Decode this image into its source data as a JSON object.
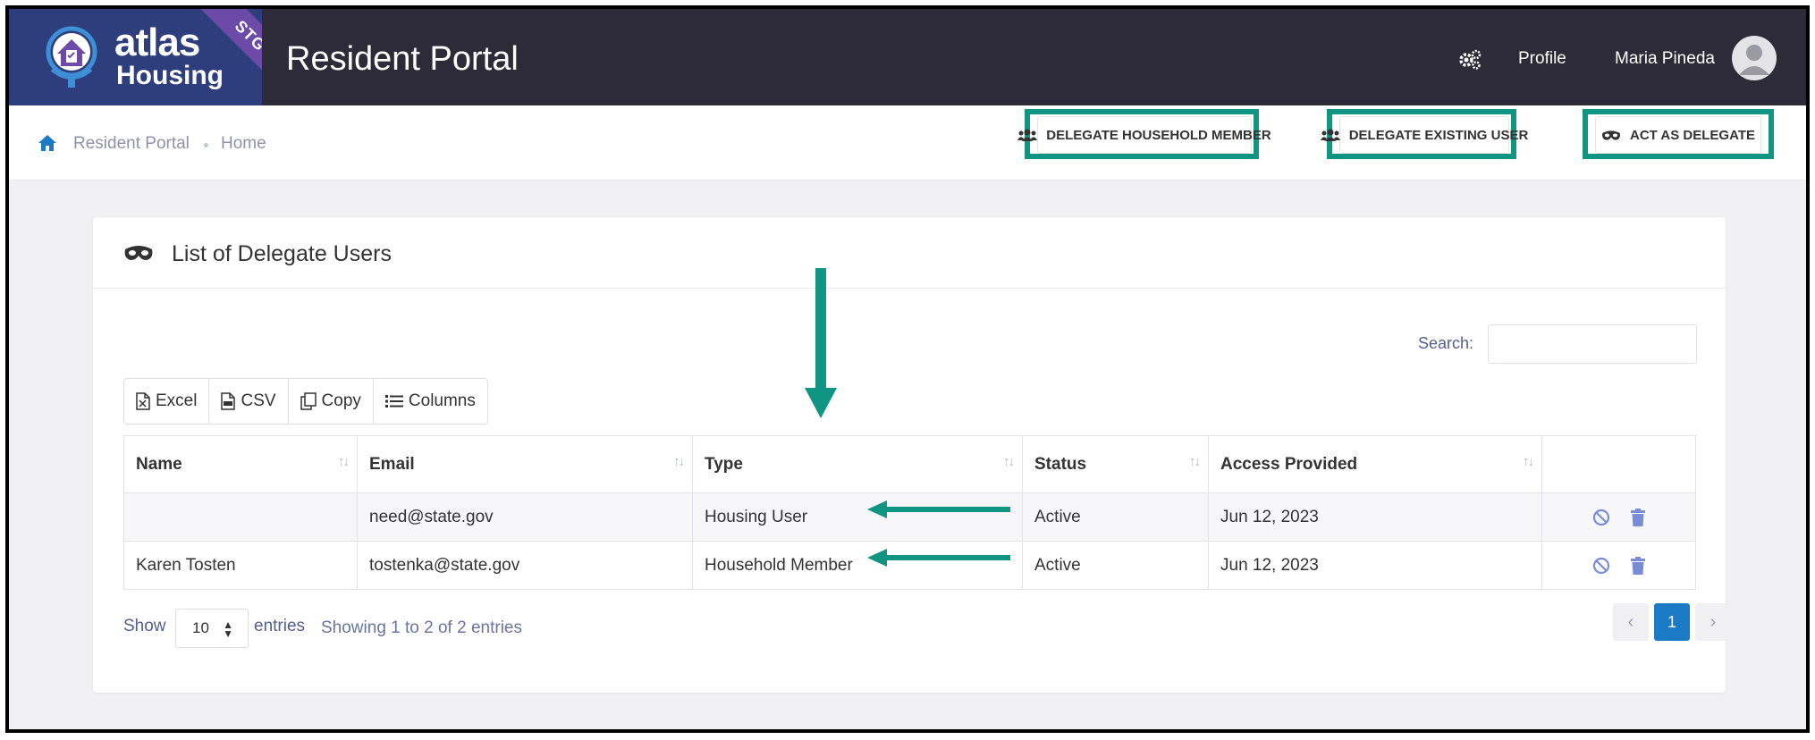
{
  "header": {
    "logo_line1": "atlas",
    "logo_line2": "Housing",
    "env_badge": "STG",
    "app_title": "Resident Portal",
    "settings_icon": "gears-icon",
    "profile_label": "Profile",
    "user_name": "Maria Pineda"
  },
  "breadcrumb": {
    "items": [
      "Resident Portal",
      "Home"
    ]
  },
  "actions": {
    "delegate_household": "DELEGATE HOUSEHOLD MEMBER",
    "delegate_existing": "DELEGATE EXISTING USER",
    "act_as_delegate": "ACT AS DELEGATE"
  },
  "card": {
    "title": "List of Delegate Users"
  },
  "search": {
    "label": "Search:",
    "value": ""
  },
  "export_buttons": {
    "excel": "Excel",
    "csv": "CSV",
    "copy": "Copy",
    "columns": "Columns"
  },
  "table": {
    "columns": [
      "Name",
      "Email",
      "Type",
      "Status",
      "Access Provided",
      ""
    ],
    "rows": [
      {
        "name": "",
        "email": "need@state.gov",
        "type": "Housing User",
        "status": "Active",
        "access": "Jun 12, 2023"
      },
      {
        "name": "Karen Tosten",
        "email": "tostenka@state.gov",
        "type": "Household Member",
        "status": "Active",
        "access": "Jun 12, 2023"
      }
    ]
  },
  "footer": {
    "show_label": "Show",
    "page_length": "10",
    "entries_label": "entries",
    "info": "Showing 1 to 2 of 2 entries",
    "current_page": "1",
    "prev_symbol": "‹",
    "next_symbol": "›"
  },
  "colors": {
    "header_bg": "#2c2b37",
    "logo_bg": "#2e3d7c",
    "highlight": "#119583",
    "primary": "#1a7bc4",
    "row_icon": "#7b8cd6"
  }
}
